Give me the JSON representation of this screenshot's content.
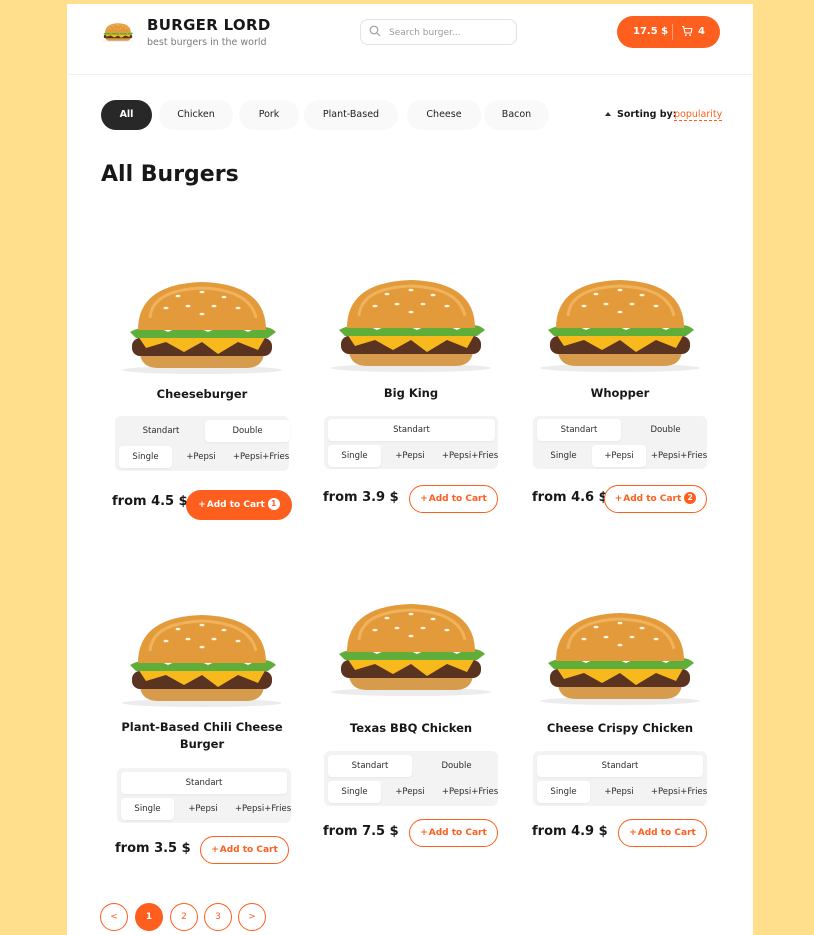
{
  "brand": {
    "title": "BURGER LORD",
    "subtitle": "best burgers in the world"
  },
  "search": {
    "placeholder": "Search burger...",
    "value": ""
  },
  "cart": {
    "total": "17.5 $",
    "count": "4"
  },
  "categories": [
    "All",
    "Chicken",
    "Pork",
    "Plant-Based",
    "Cheese",
    "Bacon"
  ],
  "active_category": "All",
  "sort": {
    "label": "Sorting by:",
    "value": "popularity"
  },
  "page_title": "All Burgers",
  "add_label": "Add to Cart",
  "products": [
    {
      "name": "Cheeseburger",
      "sizes": [
        "Standart",
        "Double"
      ],
      "active_size": "Double",
      "extras": [
        "Single",
        "+Pepsi",
        "+Pepsi+Fries"
      ],
      "active_extra": "Single",
      "price": "from 4.5 $",
      "in_cart": "1"
    },
    {
      "name": "Big King",
      "sizes": [
        "Standart"
      ],
      "active_size": "Standart",
      "extras": [
        "Single",
        "+Pepsi",
        "+Pepsi+Fries"
      ],
      "active_extra": "Single",
      "price": "from 3.9 $",
      "in_cart": ""
    },
    {
      "name": "Whopper",
      "sizes": [
        "Standart",
        "Double"
      ],
      "active_size": "Standart",
      "extras": [
        "Single",
        "+Pepsi",
        "+Pepsi+Fries"
      ],
      "active_extra": "+Pepsi",
      "price": "from 4.6 $",
      "in_cart": "2"
    },
    {
      "name": "Plant-Based Chili Cheese Burger",
      "sizes": [
        "Standart"
      ],
      "active_size": "Standart",
      "extras": [
        "Single",
        "+Pepsi",
        "+Pepsi+Fries"
      ],
      "active_extra": "Single",
      "price": "from 3.5 $",
      "in_cart": ""
    },
    {
      "name": "Texas BBQ Chicken",
      "sizes": [
        "Standart",
        "Double"
      ],
      "active_size": "Standart",
      "extras": [
        "Single",
        "+Pepsi",
        "+Pepsi+Fries"
      ],
      "active_extra": "Single",
      "price": "from 7.5 $",
      "in_cart": ""
    },
    {
      "name": "Cheese Crispy Chicken",
      "sizes": [
        "Standart"
      ],
      "active_size": "Standart",
      "extras": [
        "Single",
        "+Pepsi",
        "+Pepsi+Fries"
      ],
      "active_extra": "Single",
      "price": "from 4.9 $",
      "in_cart": ""
    }
  ],
  "pagination": {
    "prev": "<",
    "pages": [
      "1",
      "2",
      "3"
    ],
    "next": ">",
    "current": "1"
  },
  "colors": {
    "accent": "#fe5f1e",
    "background": "#ffdf8c",
    "dark": "#282828"
  }
}
